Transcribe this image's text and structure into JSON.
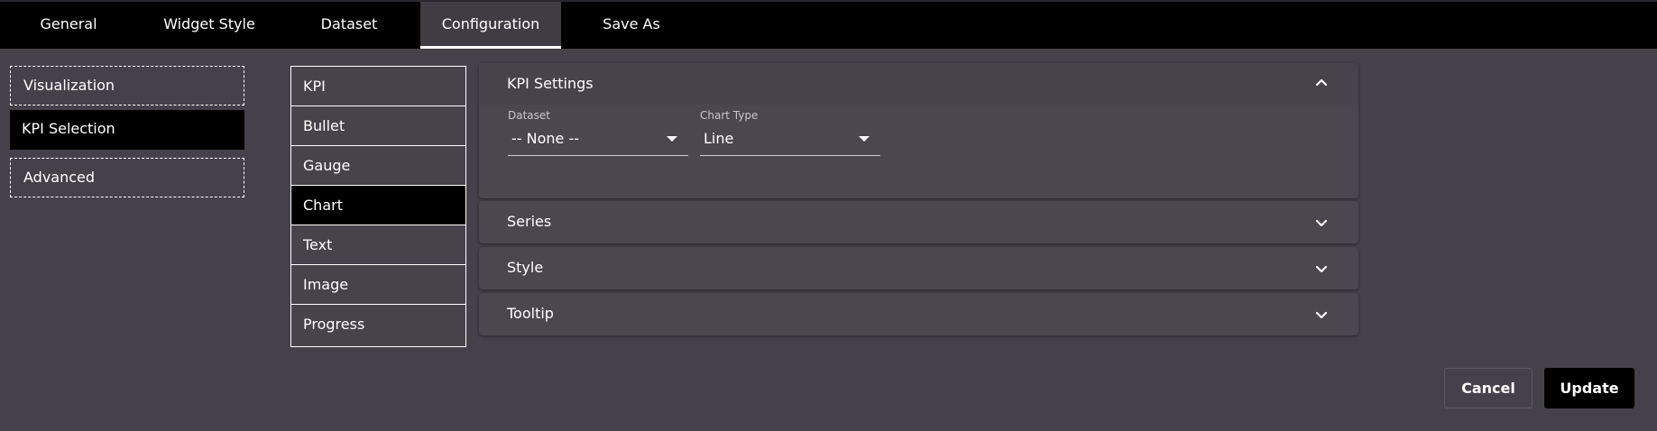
{
  "tabs": [
    {
      "label": "General"
    },
    {
      "label": "Widget Style"
    },
    {
      "label": "Dataset"
    },
    {
      "label": "Configuration",
      "active": true
    },
    {
      "label": "Save As"
    }
  ],
  "leftnav": [
    {
      "label": "Visualization"
    },
    {
      "label": "KPI Selection",
      "selected": true
    },
    {
      "label": "Advanced"
    }
  ],
  "kpi_types": [
    {
      "label": "KPI"
    },
    {
      "label": "Bullet"
    },
    {
      "label": "Gauge"
    },
    {
      "label": "Chart",
      "selected": true
    },
    {
      "label": "Text"
    },
    {
      "label": "Image"
    },
    {
      "label": "Progress"
    }
  ],
  "panels": {
    "kpi_settings": {
      "title": "KPI Settings",
      "dataset_label": "Dataset",
      "dataset_value": "-- None --",
      "chart_type_label": "Chart Type",
      "chart_type_value": "Line"
    },
    "series": {
      "title": "Series"
    },
    "style": {
      "title": "Style"
    },
    "tooltip": {
      "title": "Tooltip"
    }
  },
  "buttons": {
    "cancel": "Cancel",
    "update": "Update"
  },
  "icons": {
    "expanded": "chevron-up-icon",
    "collapsed": "chevron-down-icon"
  },
  "colors": {
    "background": "#45414a",
    "topbar": "#000000",
    "selected": "#000000",
    "panel": "#4b474f",
    "text": "#ffffff"
  }
}
